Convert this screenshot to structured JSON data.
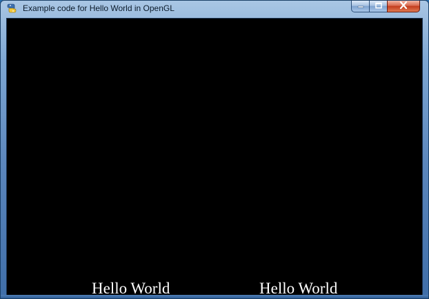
{
  "window": {
    "title": "Example code for Hello World in OpenGL",
    "icon": "python-icon",
    "controls": {
      "minimize": "minimize-icon",
      "maximize": "maximize-icon",
      "close": "close-icon"
    }
  },
  "canvas": {
    "background": "#000000",
    "text_color": "#ffffff",
    "texts": [
      "Hello World",
      "Hello World"
    ]
  }
}
